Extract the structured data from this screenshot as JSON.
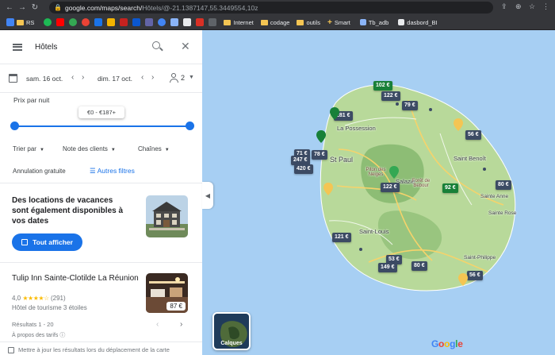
{
  "browser": {
    "url_main": "google.com/maps/search/",
    "url_rest": "Hôtels/@-21.1387147,55.3449554,10z",
    "bookmarks": [
      {
        "label": "RS",
        "kind": "folder"
      },
      {
        "label": "Internet",
        "kind": "folder"
      },
      {
        "label": "codage",
        "kind": "folder"
      },
      {
        "label": "outils",
        "kind": "folder"
      },
      {
        "label": "Smart",
        "kind": "plus"
      },
      {
        "label": "Tb_adb",
        "kind": "fav"
      },
      {
        "label": "dasbord_BI",
        "kind": "fav"
      }
    ]
  },
  "search": {
    "query": "Hôtels"
  },
  "dates": {
    "checkin": "sam. 16 oct.",
    "checkout": "dim. 17 oct.",
    "guests": "2"
  },
  "price": {
    "label": "Prix par nuit",
    "range": "€0 - €187+",
    "min_fraction": 0.0,
    "max_fraction": 1.0
  },
  "filters": {
    "sort": "Trier par",
    "reviews": "Note des clients",
    "chains": "Chaînes",
    "free_cancel": "Annulation gratuite",
    "more": "Autres filtres"
  },
  "promo": {
    "title": "Des locations de vacances sont également disponibles à vos dates",
    "button": "Tout afficher"
  },
  "hotel": {
    "name": "Tulip Inn Sainte-Clotilde La Réunion",
    "rating": "4,0",
    "stars": "★★★★☆",
    "reviews": "(291)",
    "type": "Hôtel de tourisme 3 étoiles",
    "price": "87 €"
  },
  "results": {
    "label": "Résultats 1 - 20",
    "about": "À propos des tarifs",
    "update_on_move": "Mettre à jour les résultats lors du déplacement de la carte"
  },
  "map": {
    "price_pins": [
      "102 €",
      "122 €",
      "79 €",
      "281 €",
      "56 €",
      "71 €",
      "247 €",
      "78 €",
      "420 €",
      "122 €",
      "92 €",
      "80 €",
      "121 €",
      "53 €",
      "149 €",
      "80 €",
      "56 €"
    ],
    "places": [
      "La Possession",
      "St Paul",
      "Salazie",
      "Piton des Neiges",
      "Forêt de Bébour",
      "Saint Benoît",
      "Sainte Anne",
      "Sainte Rose",
      "Saint-Louis",
      "Saint-Philippe"
    ],
    "layers_label": "Calques"
  },
  "colors": {
    "accent": "#1a73e8",
    "ocean": "#a7cff3",
    "land": "#b8d99a",
    "pin": "#3c4b64",
    "pin_green": "#188038"
  }
}
